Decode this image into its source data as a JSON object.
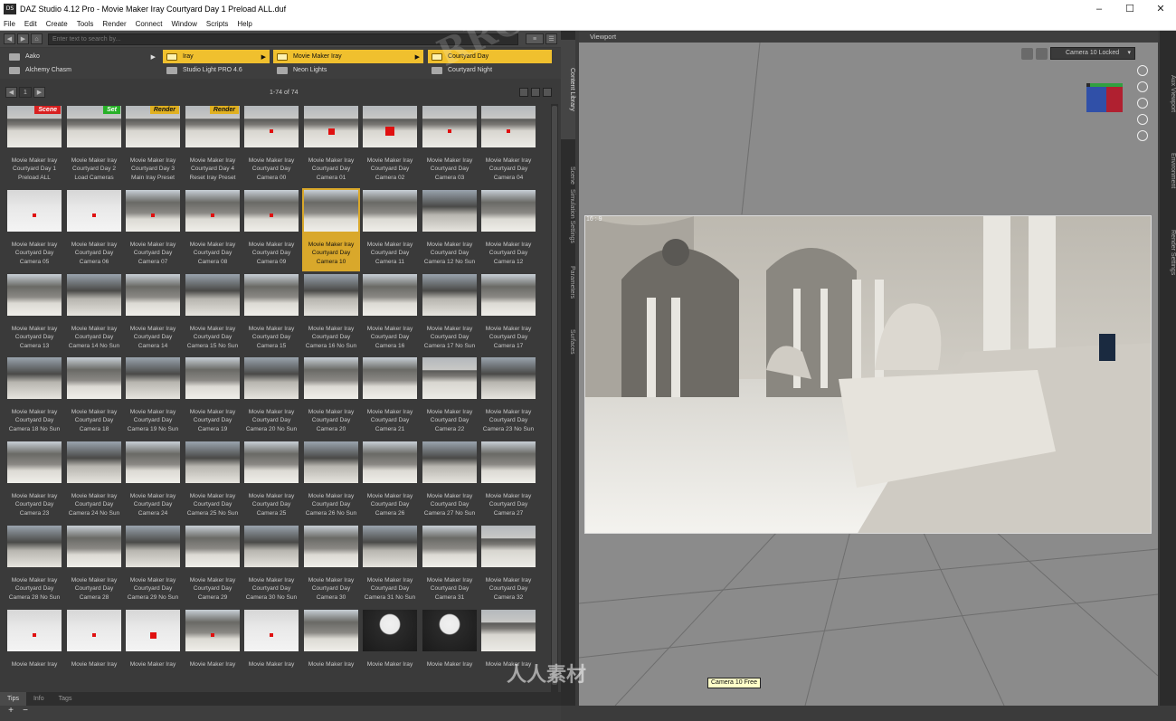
{
  "window": {
    "title": "DAZ Studio 4.12 Pro - Movie Maker Iray Courtyard Day 1 Preload ALL.duf",
    "app_icon": "DS"
  },
  "menu": [
    "File",
    "Edit",
    "Create",
    "Tools",
    "Render",
    "Connect",
    "Window",
    "Scripts",
    "Help"
  ],
  "search": {
    "placeholder": "Enter text to search by..."
  },
  "columns": [
    {
      "rows": [
        {
          "label": "Aako",
          "selected": false
        },
        {
          "label": "Alchemy Chasm",
          "selected": false
        }
      ]
    },
    {
      "rows": [
        {
          "label": "Iray",
          "selected": true
        },
        {
          "label": "Studio Light PRO 4.6",
          "selected": false
        }
      ]
    },
    {
      "rows": [
        {
          "label": "Movie Maker Iray",
          "selected": true
        },
        {
          "label": "Neon Lights",
          "selected": false
        }
      ]
    },
    {
      "rows": [
        {
          "label": "Courtyard Day",
          "selected": true
        },
        {
          "label": "Courtyard Night",
          "selected": false
        }
      ]
    }
  ],
  "pager": {
    "page": "1",
    "count": "1-74 of 74"
  },
  "items": [
    {
      "l1": "Movie Maker Iray",
      "l2": "Courtyard Day 1",
      "l3": "Preload ALL",
      "badge": "Scene",
      "v": 0
    },
    {
      "l1": "Movie Maker Iray",
      "l2": "Courtyard Day 2",
      "l3": "Load Cameras",
      "badge": "Set",
      "v": 0
    },
    {
      "l1": "Movie Maker Iray",
      "l2": "Courtyard Day 3",
      "l3": "Main Iray Preset",
      "badge": "Render",
      "v": 0
    },
    {
      "l1": "Movie Maker Iray",
      "l2": "Courtyard Day 4",
      "l3": "Reset Iray Preset",
      "badge": "Render",
      "v": 0
    },
    {
      "l1": "Movie Maker Iray",
      "l2": "Courtyard Day",
      "l3": "Camera 00",
      "v": 0,
      "red": 1
    },
    {
      "l1": "Movie Maker Iray",
      "l2": "Courtyard Day",
      "l3": "Camera 01",
      "v": 0,
      "red": 2
    },
    {
      "l1": "Movie Maker Iray",
      "l2": "Courtyard Day",
      "l3": "Camera 02",
      "v": 0,
      "red": 3
    },
    {
      "l1": "Movie Maker Iray",
      "l2": "Courtyard Day",
      "l3": "Camera 03",
      "v": 0,
      "red": 1
    },
    {
      "l1": "Movie Maker Iray",
      "l2": "Courtyard Day",
      "l3": "Camera 04",
      "v": 0,
      "red": 1
    },
    {
      "l1": "Movie Maker Iray",
      "l2": "Courtyard Day",
      "l3": "Camera 05",
      "v": 1,
      "red": 1
    },
    {
      "l1": "Movie Maker Iray",
      "l2": "Courtyard Day",
      "l3": "Camera 06",
      "v": 1,
      "red": 1
    },
    {
      "l1": "Movie Maker Iray",
      "l2": "Courtyard Day",
      "l3": "Camera 07",
      "v": 2,
      "red": 1
    },
    {
      "l1": "Movie Maker Iray",
      "l2": "Courtyard Day",
      "l3": "Camera 08",
      "v": 2,
      "red": 1
    },
    {
      "l1": "Movie Maker Iray",
      "l2": "Courtyard Day",
      "l3": "Camera 09",
      "v": 2,
      "red": 1
    },
    {
      "l1": "Movie Maker Iray",
      "l2": "Courtyard Day",
      "l3": "Camera 10",
      "v": 2,
      "selected": true
    },
    {
      "l1": "Movie Maker Iray",
      "l2": "Courtyard Day",
      "l3": "Camera 11",
      "v": 2
    },
    {
      "l1": "Movie Maker Iray",
      "l2": "Courtyard Day",
      "l3": "Camera 12 No Sun",
      "v": 4
    },
    {
      "l1": "Movie Maker Iray",
      "l2": "Courtyard Day",
      "l3": "Camera 12",
      "v": 2
    },
    {
      "l1": "Movie Maker Iray",
      "l2": "Courtyard Day",
      "l3": "Camera 13",
      "v": 2
    },
    {
      "l1": "Movie Maker Iray",
      "l2": "Courtyard Day",
      "l3": "Camera 14 No Sun",
      "v": 4
    },
    {
      "l1": "Movie Maker Iray",
      "l2": "Courtyard Day",
      "l3": "Camera 14",
      "v": 2
    },
    {
      "l1": "Movie Maker Iray",
      "l2": "Courtyard Day",
      "l3": "Camera 15 No Sun",
      "v": 4
    },
    {
      "l1": "Movie Maker Iray",
      "l2": "Courtyard Day",
      "l3": "Camera 15",
      "v": 2
    },
    {
      "l1": "Movie Maker Iray",
      "l2": "Courtyard Day",
      "l3": "Camera 16 No Sun",
      "v": 4
    },
    {
      "l1": "Movie Maker Iray",
      "l2": "Courtyard Day",
      "l3": "Camera 16",
      "v": 2
    },
    {
      "l1": "Movie Maker Iray",
      "l2": "Courtyard Day",
      "l3": "Camera 17 No Sun",
      "v": 4
    },
    {
      "l1": "Movie Maker Iray",
      "l2": "Courtyard Day",
      "l3": "Camera 17",
      "v": 2
    },
    {
      "l1": "Movie Maker Iray",
      "l2": "Courtyard Day",
      "l3": "Camera 18 No Sun",
      "v": 4
    },
    {
      "l1": "Movie Maker Iray",
      "l2": "Courtyard Day",
      "l3": "Camera 18",
      "v": 2
    },
    {
      "l1": "Movie Maker Iray",
      "l2": "Courtyard Day",
      "l3": "Camera 19 No Sun",
      "v": 4
    },
    {
      "l1": "Movie Maker Iray",
      "l2": "Courtyard Day",
      "l3": "Camera 19",
      "v": 2
    },
    {
      "l1": "Movie Maker Iray",
      "l2": "Courtyard Day",
      "l3": "Camera 20 No Sun",
      "v": 4
    },
    {
      "l1": "Movie Maker Iray",
      "l2": "Courtyard Day",
      "l3": "Camera 20",
      "v": 2
    },
    {
      "l1": "Movie Maker Iray",
      "l2": "Courtyard Day",
      "l3": "Camera 21",
      "v": 2
    },
    {
      "l1": "Movie Maker Iray",
      "l2": "Courtyard Day",
      "l3": "Camera 22",
      "v": 0
    },
    {
      "l1": "Movie Maker Iray",
      "l2": "Courtyard Day",
      "l3": "Camera 23 No Sun",
      "v": 4
    },
    {
      "l1": "Movie Maker Iray",
      "l2": "Courtyard Day",
      "l3": "Camera 23",
      "v": 2
    },
    {
      "l1": "Movie Maker Iray",
      "l2": "Courtyard Day",
      "l3": "Camera 24 No Sun",
      "v": 4
    },
    {
      "l1": "Movie Maker Iray",
      "l2": "Courtyard Day",
      "l3": "Camera 24",
      "v": 2
    },
    {
      "l1": "Movie Maker Iray",
      "l2": "Courtyard Day",
      "l3": "Camera 25 No Sun",
      "v": 4
    },
    {
      "l1": "Movie Maker Iray",
      "l2": "Courtyard Day",
      "l3": "Camera 25",
      "v": 2
    },
    {
      "l1": "Movie Maker Iray",
      "l2": "Courtyard Day",
      "l3": "Camera 26 No Sun",
      "v": 4
    },
    {
      "l1": "Movie Maker Iray",
      "l2": "Courtyard Day",
      "l3": "Camera 26",
      "v": 2
    },
    {
      "l1": "Movie Maker Iray",
      "l2": "Courtyard Day",
      "l3": "Camera 27 No Sun",
      "v": 4
    },
    {
      "l1": "Movie Maker Iray",
      "l2": "Courtyard Day",
      "l3": "Camera 27",
      "v": 2
    },
    {
      "l1": "Movie Maker Iray",
      "l2": "Courtyard Day",
      "l3": "Camera 28 No Sun",
      "v": 4
    },
    {
      "l1": "Movie Maker Iray",
      "l2": "Courtyard Day",
      "l3": "Camera 28",
      "v": 2
    },
    {
      "l1": "Movie Maker Iray",
      "l2": "Courtyard Day",
      "l3": "Camera 29 No Sun",
      "v": 4
    },
    {
      "l1": "Movie Maker Iray",
      "l2": "Courtyard Day",
      "l3": "Camera 29",
      "v": 2
    },
    {
      "l1": "Movie Maker Iray",
      "l2": "Courtyard Day",
      "l3": "Camera 30 No Sun",
      "v": 4
    },
    {
      "l1": "Movie Maker Iray",
      "l2": "Courtyard Day",
      "l3": "Camera 30",
      "v": 2
    },
    {
      "l1": "Movie Maker Iray",
      "l2": "Courtyard Day",
      "l3": "Camera 31 No Sun",
      "v": 4
    },
    {
      "l1": "Movie Maker Iray",
      "l2": "Courtyard Day",
      "l3": "Camera 31",
      "v": 2
    },
    {
      "l1": "Movie Maker Iray",
      "l2": "Courtyard Day",
      "l3": "Camera 32",
      "v": 0
    },
    {
      "l1": "Movie Maker Iray",
      "l2": "",
      "l3": "",
      "v": 1,
      "red": 1
    },
    {
      "l1": "Movie Maker Iray",
      "l2": "",
      "l3": "",
      "v": 1,
      "red": 1
    },
    {
      "l1": "Movie Maker Iray",
      "l2": "",
      "l3": "",
      "v": 1,
      "red": 2
    },
    {
      "l1": "Movie Maker Iray",
      "l2": "",
      "l3": "",
      "v": 2,
      "red": 1
    },
    {
      "l1": "Movie Maker Iray",
      "l2": "",
      "l3": "",
      "v": 1,
      "red": 1
    },
    {
      "l1": "Movie Maker Iray",
      "l2": "",
      "l3": "",
      "v": 2
    },
    {
      "l1": "Movie Maker Iray",
      "l2": "",
      "l3": "",
      "v": 3
    },
    {
      "l1": "Movie Maker Iray",
      "l2": "",
      "l3": "",
      "v": 3
    },
    {
      "l1": "Movie Maker Iray",
      "l2": "",
      "l3": "",
      "v": 0
    }
  ],
  "bottom_tabs": [
    {
      "label": "Tips",
      "active": true
    },
    {
      "label": "Info",
      "active": false
    },
    {
      "label": "Tags",
      "active": false
    }
  ],
  "side_tabs": [
    "Content Library",
    "Scene",
    "Simulation Settings",
    "Parameters",
    "Surfaces"
  ],
  "right_tabs": [
    "Aux Viewport",
    "Environment",
    "Render Settings"
  ],
  "viewport": {
    "title": "Viewport",
    "camera": "Camera 10 Locked",
    "aspect": "16 : 9",
    "camera_tag": "Camera 10 Free"
  },
  "watermark": {
    "text": "RRCG",
    "logo": "人人素材"
  },
  "colors": {
    "selection": "#f0c02e",
    "scene_badge": "#d82020",
    "set_badge": "#28b028",
    "render_badge": "#e0b020"
  }
}
